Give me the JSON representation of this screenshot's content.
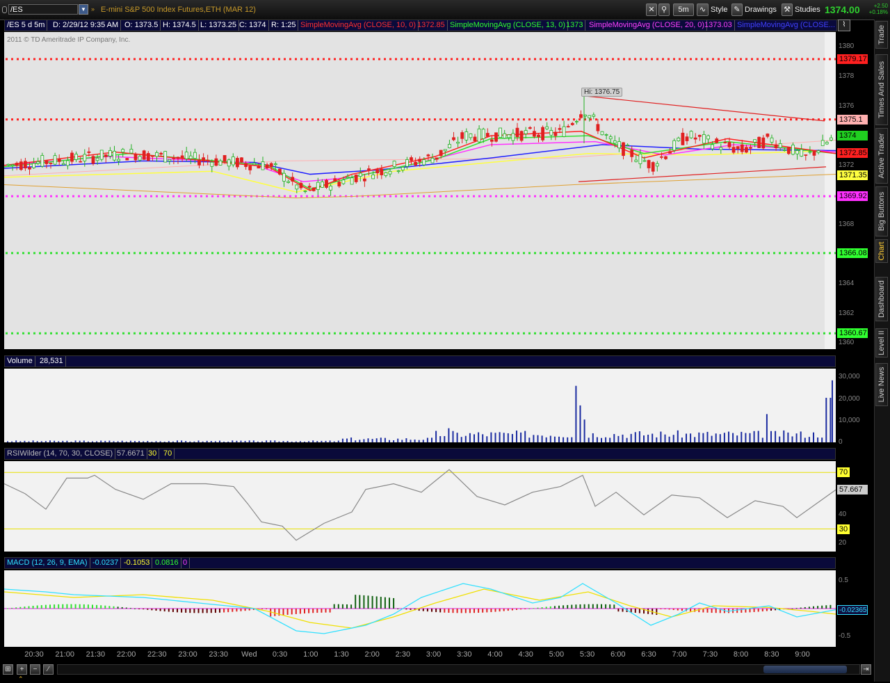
{
  "toolbar": {
    "symbol": "/ES",
    "instrument_name": "E-mini S&P 500 Index Futures,ETH (MAR 12)",
    "timeframe": "5m",
    "style_label": "Style",
    "drawings_label": "Drawings",
    "studies_label": "Studies",
    "last_price": "1374.00",
    "change_abs": "+2.50",
    "change_pct": "+0.18%"
  },
  "side_tabs": [
    "Trade",
    "Times And Sales",
    "Active Trader",
    "Big Buttons",
    "Chart",
    "Dashboard",
    "Level II",
    "Live News"
  ],
  "price_header": {
    "symbol_period": "/ES 5 d 5m",
    "date": "D: 2/29/12 9:35 AM",
    "open": "O: 1373.5",
    "high": "H: 1374.5",
    "low": "L: 1373.25",
    "close": "C: 1374",
    "range": "R: 1:25",
    "sma10_label": "SimpleMovingAvg (CLOSE, 10, 0)",
    "sma10_value": "1372.85",
    "sma13_label": "SimpleMovingAvg (CLOSE, 13, 0)",
    "sma13_value": "1373",
    "sma20_label": "SimpleMovingAvg (CLOSE, 20, 0)",
    "sma20_value": "1373.03",
    "sma_blue_label": "SimpleMovingAvg (CLOSE..."
  },
  "copyright": "2011 © TD Ameritrade IP Company, Inc.",
  "hi_label": "Hi: 1376.75",
  "price_axis": [
    "1380",
    "1378",
    "1376",
    "1374",
    "1372",
    "1370",
    "1368",
    "1366",
    "1364",
    "1362",
    "1360"
  ],
  "price_boxes": [
    {
      "value": "1379.17",
      "bg": "#ff2020"
    },
    {
      "value": "1375.1",
      "bg": "#ffb0b0"
    },
    {
      "value": "1374",
      "bg": "#20d020"
    },
    {
      "value": "1372.85",
      "bg": "#ff2020"
    },
    {
      "value": "1371.35",
      "bg": "#ffff40"
    },
    {
      "value": "1369.92",
      "bg": "#ff30ff"
    },
    {
      "value": "1366.08",
      "bg": "#30ff30"
    },
    {
      "value": "1360.67",
      "bg": "#30ff30"
    }
  ],
  "volume": {
    "label": "Volume",
    "value": "28,531",
    "axis": [
      "30,000",
      "20,000",
      "10,000",
      "0"
    ]
  },
  "rsi": {
    "label": "RSIWilder (14, 70, 30, CLOSE)",
    "value": "57.6671",
    "os": "30",
    "ob": "70",
    "axis_value": "57.667",
    "axis": [
      "70",
      "40",
      "30",
      "20"
    ]
  },
  "macd": {
    "label": "MACD (12, 26, 9, EMA)",
    "value": "-0.0237",
    "avg": "-0.1053",
    "diff": "0.0816",
    "zero": "0",
    "axis": [
      "0.5",
      "-0.02365",
      "-0.5"
    ]
  },
  "time_axis": [
    "20:30",
    "21:00",
    "21:30",
    "22:00",
    "22:30",
    "23:00",
    "23:30",
    "Wed",
    "0:30",
    "1:00",
    "1:30",
    "2:00",
    "2:30",
    "3:00",
    "3:30",
    "4:00",
    "4:30",
    "5:00",
    "5:30",
    "6:00",
    "6:30",
    "7:00",
    "7:30",
    "8:00",
    "8:30",
    "9:00"
  ],
  "colors": {
    "up": "#20d020",
    "down": "#e02020",
    "sma10": "#ff2020",
    "sma13": "#30ff30",
    "sma20": "#ff30ff",
    "sma_blue": "#2020ff",
    "rsi": "#888888",
    "macd": "#30e0ff",
    "macd_avg": "#ffff30"
  }
}
